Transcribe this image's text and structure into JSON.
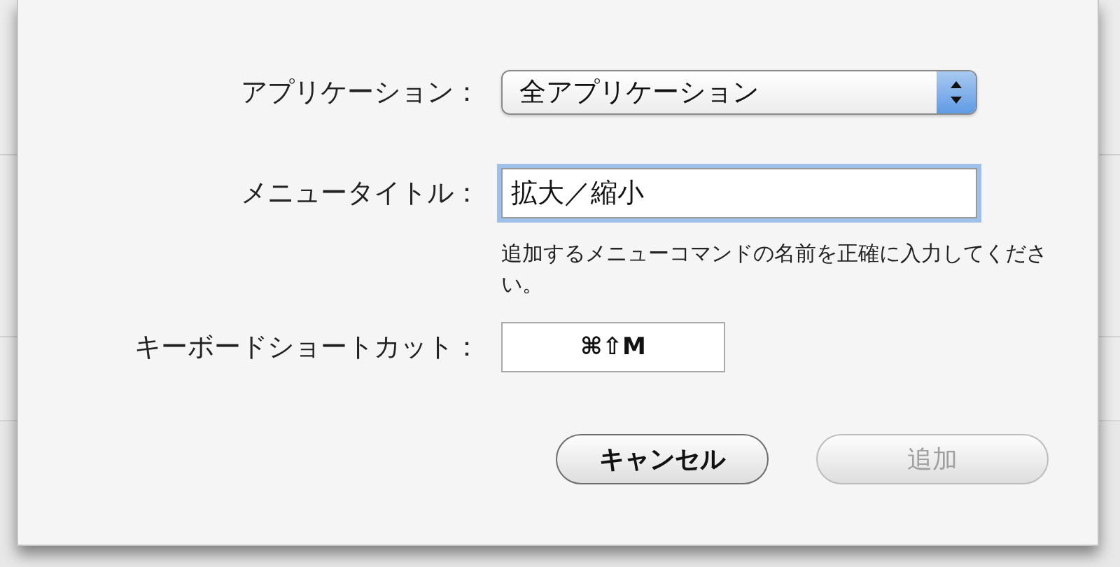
{
  "sheet": {
    "fields": [
      {
        "kind": "popup",
        "label": "アプリケーション：",
        "value": "全アプリケーション"
      },
      {
        "kind": "text",
        "label": "メニュータイトル：",
        "value": "拡大／縮小",
        "focused": true,
        "help": "追加するメニューコマンドの名前を正確に入力してください。"
      },
      {
        "kind": "shortcut",
        "label": "キーボードショートカット：",
        "value": "⌘⇧M"
      }
    ],
    "buttons": [
      {
        "label": "キャンセル",
        "disabled": false
      },
      {
        "label": "追加",
        "disabled": true
      }
    ]
  }
}
